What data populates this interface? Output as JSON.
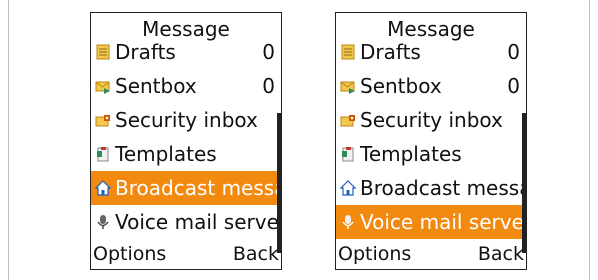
{
  "screens": [
    {
      "title": "Message",
      "items": [
        {
          "label": "Drafts",
          "count": "0",
          "icon": "drafts-icon",
          "selected": false
        },
        {
          "label": "Sentbox",
          "count": "0",
          "icon": "sentbox-icon",
          "selected": false
        },
        {
          "label": "Security inbox",
          "count": "",
          "icon": "security-inbox-icon",
          "selected": false
        },
        {
          "label": "Templates",
          "count": "",
          "icon": "templates-icon",
          "selected": false
        },
        {
          "label": "Broadcast messa",
          "count": "",
          "icon": "broadcast-home-icon",
          "selected": true
        },
        {
          "label": "Voice mail server",
          "count": "",
          "icon": "voicemail-icon",
          "selected": false
        }
      ],
      "softkeys": {
        "left": "Options",
        "right": "Back"
      }
    },
    {
      "title": "Message",
      "items": [
        {
          "label": "Drafts",
          "count": "0",
          "icon": "drafts-icon",
          "selected": false
        },
        {
          "label": "Sentbox",
          "count": "0",
          "icon": "sentbox-icon",
          "selected": false
        },
        {
          "label": "Security inbox",
          "count": "",
          "icon": "security-inbox-icon",
          "selected": false
        },
        {
          "label": "Templates",
          "count": "",
          "icon": "templates-icon",
          "selected": false
        },
        {
          "label": "Broadcast messa",
          "count": "",
          "icon": "broadcast-home-icon",
          "selected": false
        },
        {
          "label": "Voice mail server",
          "count": "",
          "icon": "voicemail-icon",
          "selected": true
        }
      ],
      "softkeys": {
        "left": "Options",
        "right": "Back"
      }
    }
  ],
  "colors": {
    "highlight": "#f28a10",
    "text": "#111111",
    "border": "#222222"
  }
}
